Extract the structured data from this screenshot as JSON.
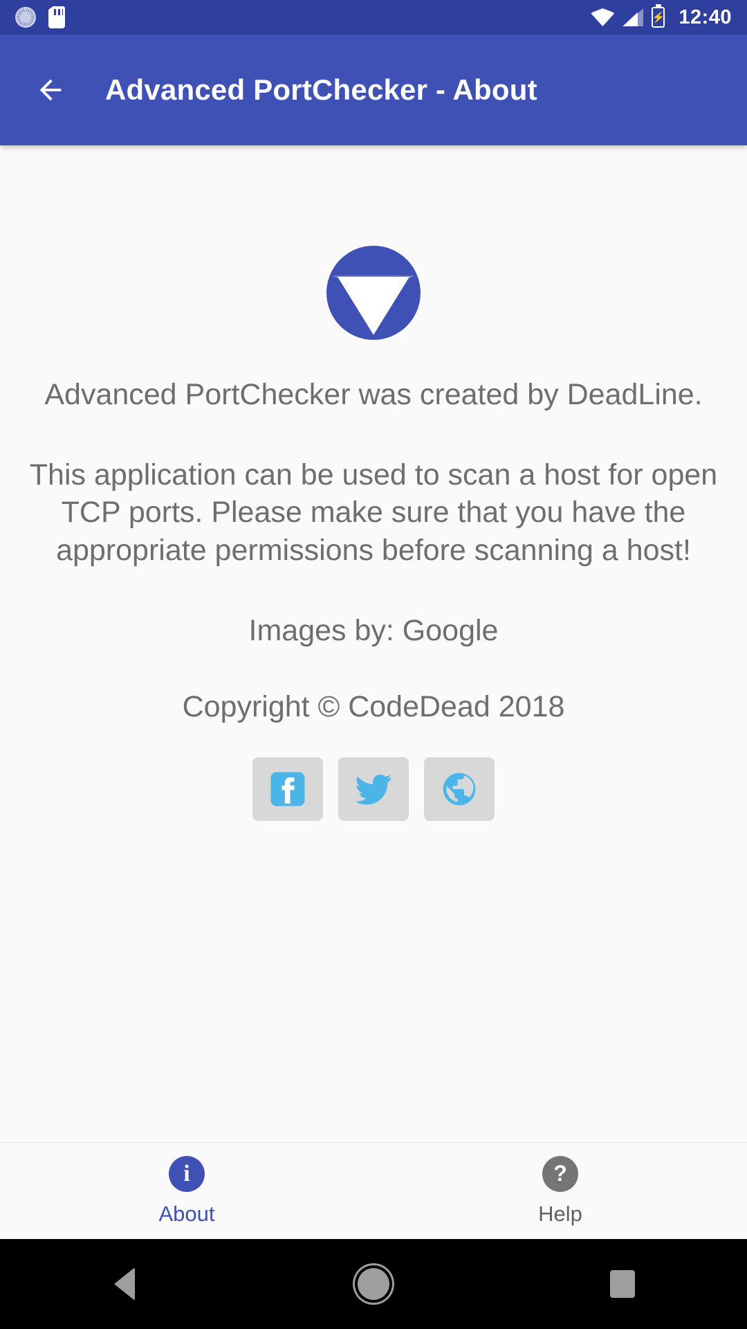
{
  "status_bar": {
    "icons_left": [
      "sync-icon",
      "sd-card-icon"
    ],
    "icons_right": [
      "wifi-icon",
      "cell-signal-icon",
      "battery-charging-icon"
    ],
    "time": "12:40"
  },
  "app_bar": {
    "back_icon": "back-arrow-icon",
    "title": "Advanced PortChecker - About",
    "background_color": "#3f51b5"
  },
  "content": {
    "logo": "app-logo-wifi-icon",
    "paragraphs": {
      "credit": "Advanced PortChecker was created by DeadLine.",
      "description": "This application can be used to scan a host for open TCP ports. Please make sure that you have the appropriate permissions before scanning a host!",
      "images_by": "Images by: Google",
      "copyright": "Copyright © CodeDead 2018"
    },
    "social_buttons": [
      {
        "name": "facebook-button",
        "icon": "facebook-icon",
        "color": "#4cb5e8"
      },
      {
        "name": "twitter-button",
        "icon": "twitter-icon",
        "color": "#4cb5e8"
      },
      {
        "name": "website-button",
        "icon": "globe-icon",
        "color": "#4cb5e8"
      }
    ]
  },
  "bottom_nav": {
    "items": [
      {
        "label": "About",
        "icon": "info-circle-icon",
        "active": true,
        "color": "#3f51b5"
      },
      {
        "label": "Help",
        "icon": "question-circle-icon",
        "active": false,
        "color": "#757575"
      }
    ]
  },
  "system_nav": {
    "back": "back-triangle-icon",
    "home": "home-circle-icon",
    "recents": "recents-square-icon"
  }
}
